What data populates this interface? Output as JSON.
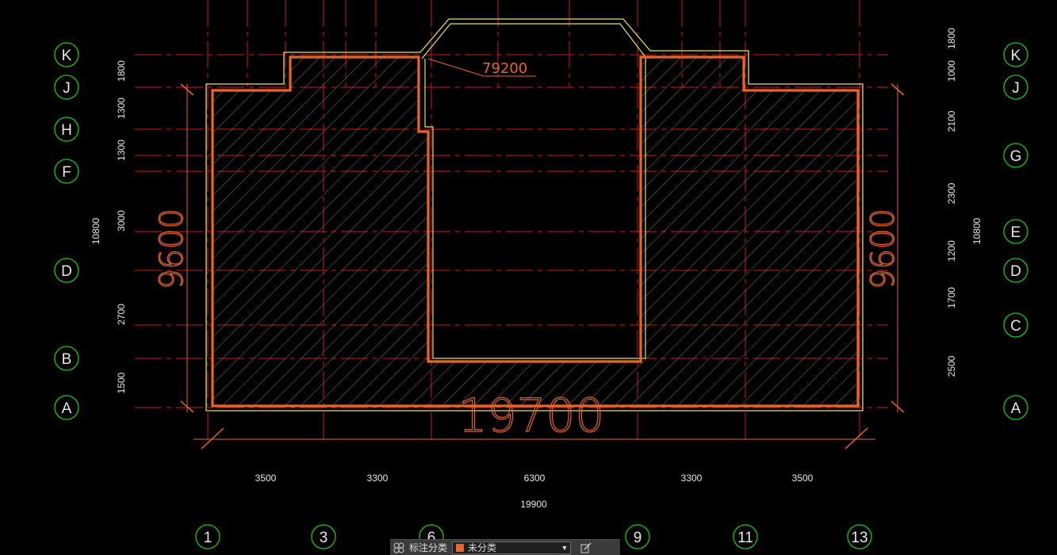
{
  "drawing": {
    "area_label": "79200",
    "width_dim_label": "19700",
    "height_dim_left": "9600",
    "height_dim_right": "9600",
    "left_axes": [
      "K",
      "J",
      "H",
      "F",
      "D",
      "B",
      "A"
    ],
    "left_dims": [
      "1800",
      "1300",
      "1300",
      "3000",
      "2700",
      "1500"
    ],
    "left_total": "10800",
    "right_axes": [
      "K",
      "J",
      "G",
      "E",
      "D",
      "C",
      "A"
    ],
    "right_dims": [
      "1800",
      "1000",
      "2100",
      "2300",
      "1200",
      "1700",
      "2500"
    ],
    "right_total": "10800",
    "bottom_axes": [
      "1",
      "3",
      "6",
      "9",
      "11",
      "13"
    ],
    "bottom_dims": [
      "3500",
      "3300",
      "6300",
      "3300",
      "3500"
    ],
    "bottom_total": "19900",
    "colors": {
      "boundary": "#e8642c",
      "outline": "#e0e070",
      "axis_red": "#d01818",
      "dimension_green": "#18c818",
      "hatch": "#7a7a7a"
    }
  },
  "toolbar": {
    "icon": "layers-icon",
    "label": "标注分类",
    "category_value": "未分类",
    "category_color": "#e8642c",
    "edit_icon": "edit-icon"
  }
}
